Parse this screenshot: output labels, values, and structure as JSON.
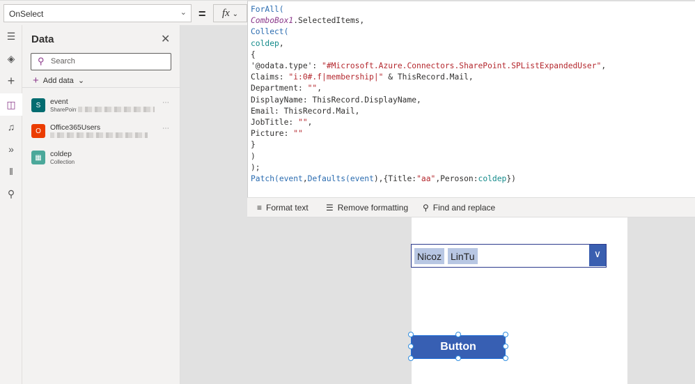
{
  "formula_bar": {
    "property": "OnSelect",
    "equals": "=",
    "fx_label": "fx"
  },
  "code_lines": [
    [
      [
        "kw",
        "ForAll("
      ]
    ],
    [
      [
        "ctl",
        "ComboBox1"
      ],
      [
        "plain",
        ".SelectedItems,"
      ]
    ],
    [
      [
        "kw",
        "Collect("
      ]
    ],
    [
      [
        "col",
        "coldep"
      ],
      [
        "plain",
        ","
      ]
    ],
    [
      [
        "plain",
        "{"
      ]
    ],
    [
      [
        "plain",
        "'@odata.type': "
      ],
      [
        "str",
        "\"#Microsoft.Azure.Connectors.SharePoint.SPListExpandedUser\""
      ],
      [
        "plain",
        ","
      ]
    ],
    [
      [
        "plain",
        "Claims: "
      ],
      [
        "str",
        "\"i:0#.f|membership|\""
      ],
      [
        "plain",
        " & ThisRecord.Mail,"
      ]
    ],
    [
      [
        "plain",
        "Department: "
      ],
      [
        "str",
        "\"\""
      ],
      [
        "plain",
        ","
      ]
    ],
    [
      [
        "plain",
        "DisplayName: ThisRecord.DisplayName,"
      ]
    ],
    [
      [
        "plain",
        "Email: ThisRecord.Mail,"
      ]
    ],
    [
      [
        "plain",
        "JobTitle: "
      ],
      [
        "str",
        "\"\""
      ],
      [
        "plain",
        ","
      ]
    ],
    [
      [
        "plain",
        "Picture: "
      ],
      [
        "str",
        "\"\""
      ]
    ],
    [
      [
        "plain",
        "}"
      ]
    ],
    [
      [
        "plain",
        ")"
      ]
    ],
    [
      [
        "plain",
        ");"
      ]
    ],
    [
      [
        "kw",
        "Patch("
      ],
      [
        "kw",
        "event"
      ],
      [
        "plain",
        ","
      ],
      [
        "kw",
        "Defaults("
      ],
      [
        "kw",
        "event"
      ],
      [
        "plain",
        "),{Title:"
      ],
      [
        "str",
        "\"aa\""
      ],
      [
        "plain",
        ",Peroson:"
      ],
      [
        "col",
        "coldep"
      ],
      [
        "plain",
        "})"
      ]
    ]
  ],
  "toolbar": {
    "format_text": "Format text",
    "remove_formatting": "Remove formatting",
    "find_replace": "Find and replace"
  },
  "panel": {
    "title": "Data",
    "search_placeholder": "Search",
    "add_data": "Add data",
    "sources": [
      {
        "name": "event",
        "subtitle": "SharePoint",
        "icon": "sharepoint-icon",
        "color": "#036c70"
      },
      {
        "name": "Office365Users",
        "subtitle": "",
        "icon": "office-icon",
        "color": "#eb3c00"
      },
      {
        "name": "coldep",
        "subtitle": "Collection",
        "icon": "collection-icon",
        "color": "#4ba89a"
      }
    ]
  },
  "canvas": {
    "combobox_items": [
      "Nicoz",
      "LinTu"
    ],
    "button_label": "Button"
  }
}
